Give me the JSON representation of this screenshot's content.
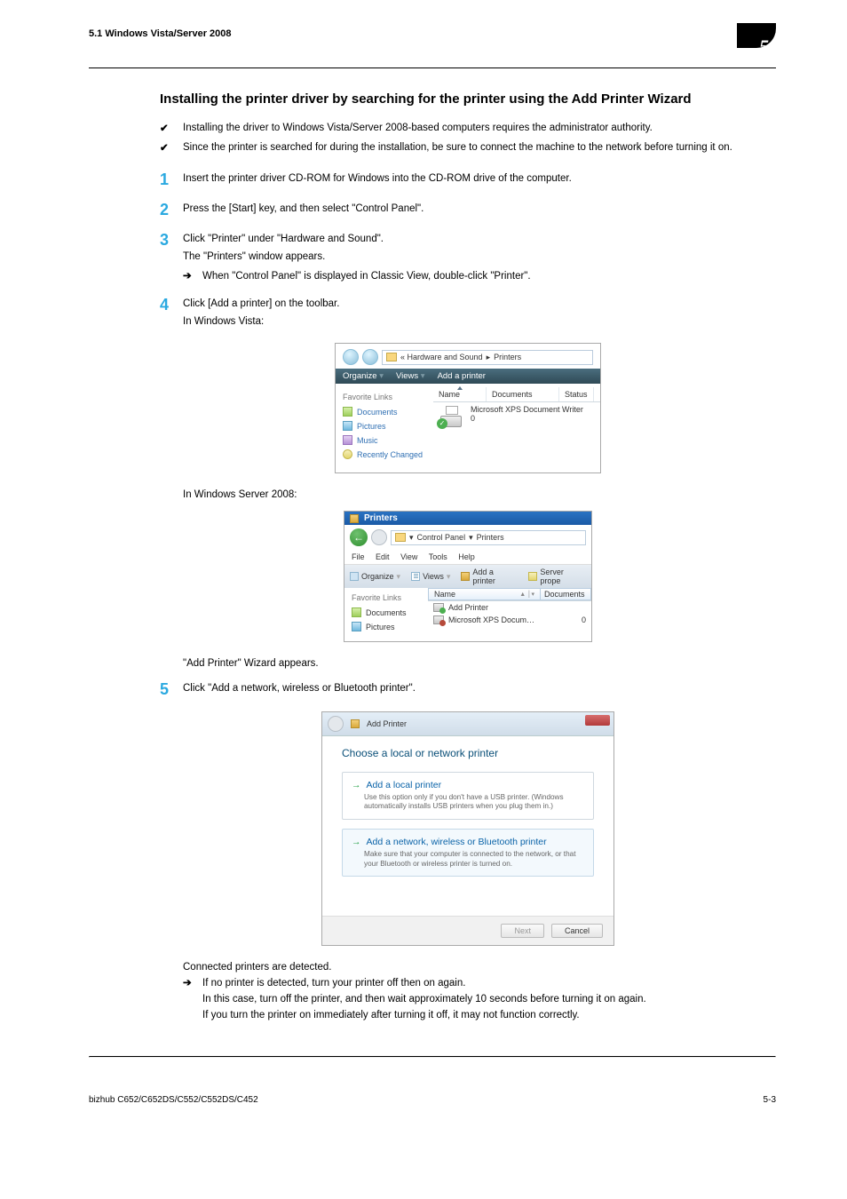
{
  "header": {
    "left": "5.1    Windows Vista/Server 2008",
    "chapter_num": "5"
  },
  "h2": "Installing the printer driver by searching for the printer using the Add Printer Wizard",
  "checks": [
    "Installing the driver to Windows Vista/Server 2008-based computers requires the administrator authority.",
    "Since the printer is searched for during the installation, be sure to connect the machine to the network before turning it on."
  ],
  "steps": {
    "s1": "Insert the printer driver CD-ROM for Windows into the CD-ROM drive of the computer.",
    "s2": "Press the [Start] key, and then select \"Control Panel\".",
    "s3": "Click \"Printer\" under \"Hardware and Sound\".",
    "s3_sub": "The \"Printers\" window appears.",
    "s3_arrow": "When \"Control Panel\" is displayed in Classic View, double-click \"Printer\".",
    "s4": "Click [Add a printer] on the toolbar.",
    "s4_sub": "In Windows Vista:",
    "s4_sub2": "In Windows Server 2008:",
    "s4_after": "\"Add Printer\" Wizard appears.",
    "s5": "Click \"Add a network, wireless or Bluetooth printer\".",
    "s5_after": "Connected printers are detected.",
    "s5_arrow": "If no printer is detected, turn your printer off then on again.",
    "s5_tail1": "In this case, turn off the printer, and then wait approximately 10 seconds before turning it on again.",
    "s5_tail2": "If you turn the printer on immediately after turning it off, it may not function correctly."
  },
  "fig1": {
    "addr_left": "« Hardware and Sound",
    "addr_right": "Printers",
    "toolbar": {
      "organize": "Organize",
      "views": "Views",
      "add": "Add a printer"
    },
    "fav_title": "Favorite Links",
    "fav": [
      "Documents",
      "Pictures",
      "Music",
      "Recently Changed"
    ],
    "cols": {
      "name": "Name",
      "docs": "Documents",
      "status": "Status"
    },
    "printer_name": "Microsoft XPS Document Writer",
    "printer_count": "0"
  },
  "fig2": {
    "title": "Printers",
    "addr1": "Control Panel",
    "addr2": "Printers",
    "menu": [
      "File",
      "Edit",
      "View",
      "Tools",
      "Help"
    ],
    "toolbar": {
      "organize": "Organize",
      "views": "Views",
      "add": "Add a printer",
      "server": "Server prope"
    },
    "fav_title": "Favorite Links",
    "fav": [
      "Documents",
      "Pictures"
    ],
    "cols": {
      "name": "Name",
      "docs": "Documents"
    },
    "rows": [
      {
        "name": "Add Printer",
        "docs": ""
      },
      {
        "name": "Microsoft XPS Docum…",
        "docs": "0"
      }
    ]
  },
  "fig3": {
    "title": "Add Printer",
    "heading": "Choose a local or network printer",
    "opt1_h": "Add a local printer",
    "opt1_d": "Use this option only if you don't have a USB printer. (Windows automatically installs USB printers when you plug them in.)",
    "opt2_h": "Add a network, wireless or Bluetooth printer",
    "opt2_d": "Make sure that your computer is connected to the network, or that your Bluetooth or wireless printer is turned on.",
    "btn_next": "Next",
    "btn_cancel": "Cancel"
  },
  "footer": {
    "left": "bizhub C652/C652DS/C552/C552DS/C452",
    "right": "5-3"
  }
}
